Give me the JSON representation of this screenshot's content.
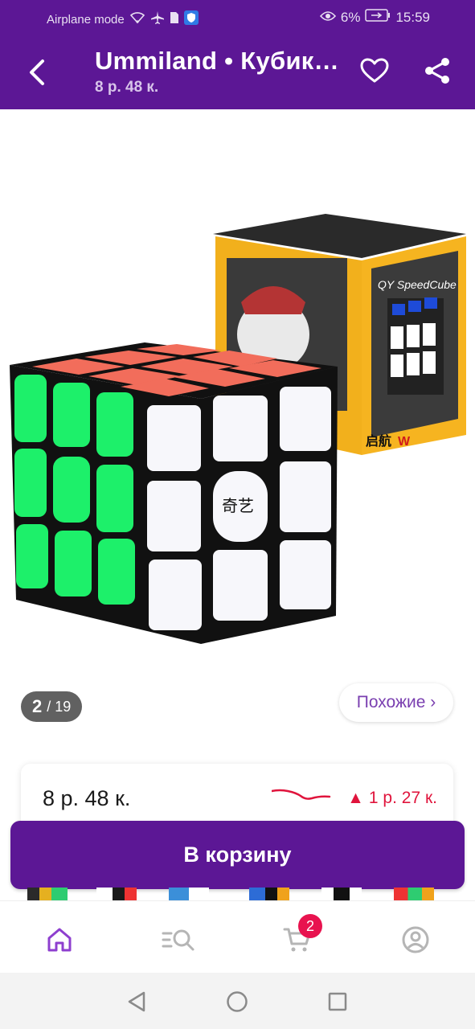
{
  "status_bar": {
    "left_text": "Airplane mode",
    "battery": "6%",
    "time": "15:59"
  },
  "header": {
    "title": "Ummiland • Кубик…",
    "subtitle": "8 р. 48 к."
  },
  "gallery": {
    "current": "2",
    "total": "/ 19",
    "similar_label": "Похожие ›"
  },
  "price_card": {
    "price": "8 р. 48 к.",
    "change": "1 р. 27 к.",
    "change_arrow": "▲"
  },
  "cart_button": "В корзину",
  "bottom_nav": {
    "cart_badge": "2",
    "active": "home"
  },
  "colors": {
    "brand_purple": "#5c1795",
    "accent_red": "#e0143c",
    "badge": "#e8134f"
  }
}
